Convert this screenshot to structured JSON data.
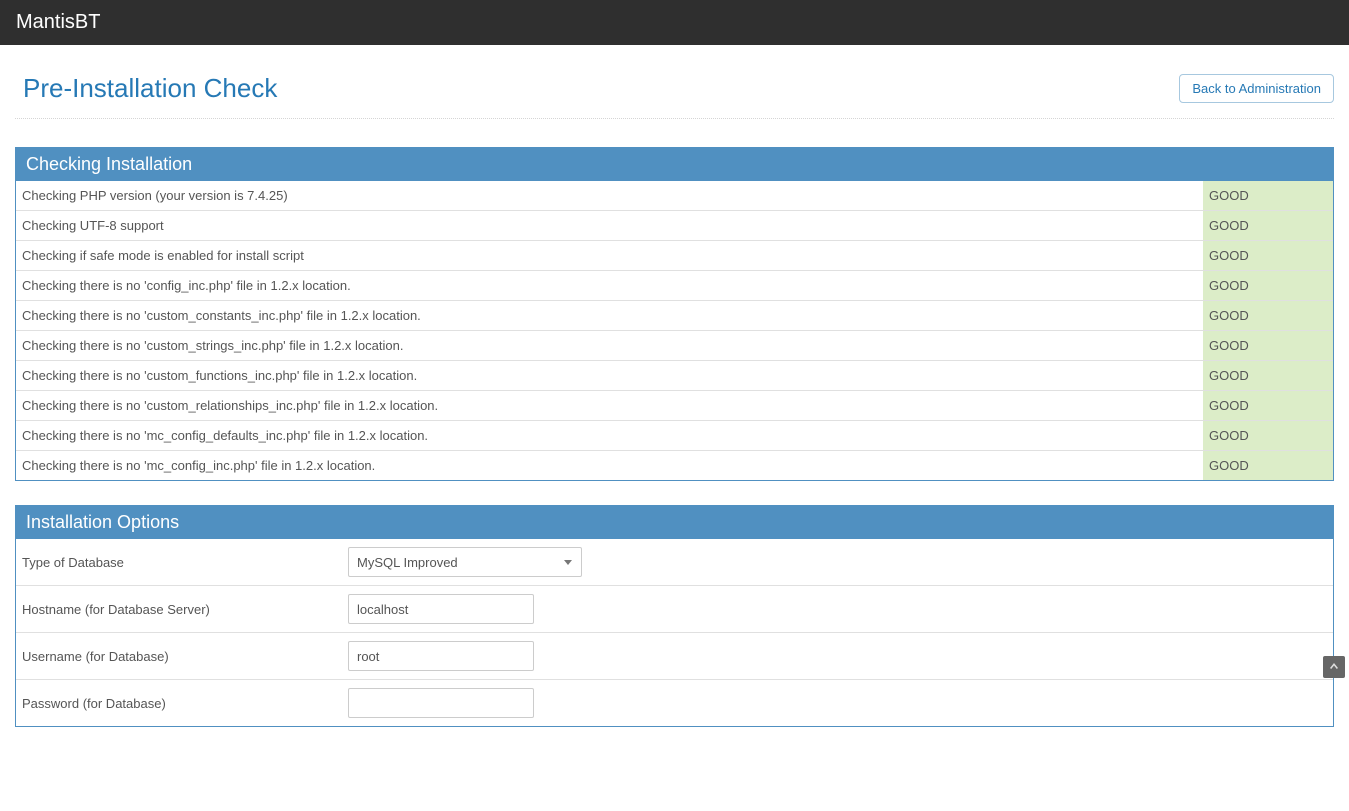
{
  "topbar": {
    "title": "MantisBT"
  },
  "header": {
    "title": "Pre-Installation Check",
    "back_button": "Back to Administration"
  },
  "check_panel": {
    "title": "Checking Installation",
    "rows": [
      {
        "label": "Checking PHP version (your version is 7.4.25)",
        "status": "GOOD"
      },
      {
        "label": "Checking UTF-8 support",
        "status": "GOOD"
      },
      {
        "label": "Checking if safe mode is enabled for install script",
        "status": "GOOD"
      },
      {
        "label": "Checking there is no 'config_inc.php' file in 1.2.x location.",
        "status": "GOOD"
      },
      {
        "label": "Checking there is no 'custom_constants_inc.php' file in 1.2.x location.",
        "status": "GOOD"
      },
      {
        "label": "Checking there is no 'custom_strings_inc.php' file in 1.2.x location.",
        "status": "GOOD"
      },
      {
        "label": "Checking there is no 'custom_functions_inc.php' file in 1.2.x location.",
        "status": "GOOD"
      },
      {
        "label": "Checking there is no 'custom_relationships_inc.php' file in 1.2.x location.",
        "status": "GOOD"
      },
      {
        "label": "Checking there is no 'mc_config_defaults_inc.php' file in 1.2.x location.",
        "status": "GOOD"
      },
      {
        "label": "Checking there is no 'mc_config_inc.php' file in 1.2.x location.",
        "status": "GOOD"
      }
    ]
  },
  "options_panel": {
    "title": "Installation Options",
    "db_type": {
      "label": "Type of Database",
      "selected": "MySQL Improved"
    },
    "hostname": {
      "label": "Hostname (for Database Server)",
      "value": "localhost"
    },
    "username": {
      "label": "Username (for Database)",
      "value": "root"
    },
    "password": {
      "label": "Password (for Database)",
      "value": ""
    }
  }
}
